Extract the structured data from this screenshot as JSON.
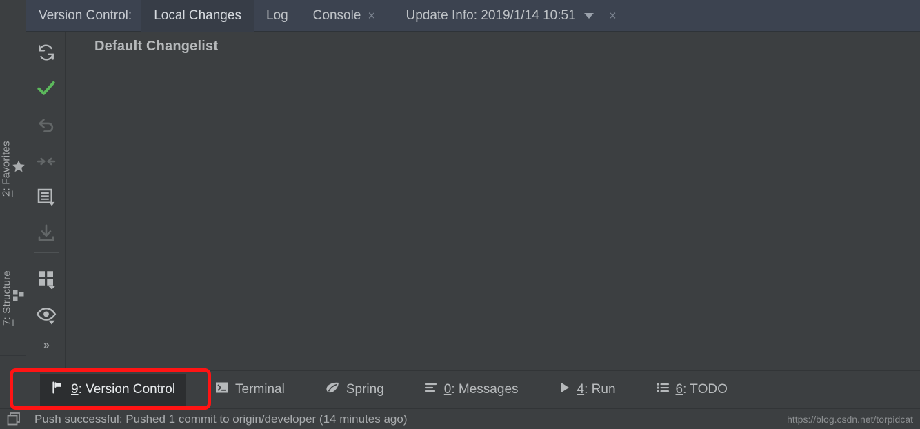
{
  "window": {
    "theme_bg": "#3C3F41",
    "tabbar_bg": "#3C4350",
    "accent_red": "#FF1414",
    "check_green": "#5CB85C"
  },
  "tabbar": {
    "label": "Version Control:",
    "tabs": [
      {
        "label": "Local Changes",
        "active": true,
        "closable": false
      },
      {
        "label": "Log",
        "active": false,
        "closable": false
      },
      {
        "label": "Console",
        "active": false,
        "closable": true,
        "close_glyph": "×"
      },
      {
        "label": "Update Info: 2019/1/14 10:51",
        "active": false,
        "closable": true,
        "has_caret": true,
        "close_glyph": "×"
      }
    ]
  },
  "left_rail": {
    "items": [
      {
        "label_prefix": "2",
        "label": ": Favorites",
        "icon": "star-icon"
      },
      {
        "label_prefix": "7",
        "label": ": Structure",
        "icon": "structure-icon"
      }
    ]
  },
  "vcs_toolbar": {
    "buttons": [
      {
        "name": "refresh-icon",
        "tooltip": "Refresh",
        "enabled": true
      },
      {
        "name": "commit-check-icon",
        "tooltip": "Commit",
        "enabled": true,
        "color": "#5CB85C"
      },
      {
        "name": "rollback-icon",
        "tooltip": "Rollback",
        "enabled": false
      },
      {
        "name": "shelve-icon",
        "tooltip": "Shelve Silently",
        "enabled": false
      },
      {
        "name": "changelist-icon",
        "tooltip": "Changelists",
        "enabled": true,
        "has_dropdown": true
      },
      {
        "name": "download-icon",
        "tooltip": "Get from Shelf",
        "enabled": false
      },
      {
        "name": "group-by-icon",
        "tooltip": "Group By",
        "enabled": true,
        "has_dropdown": true
      },
      {
        "name": "preview-eye-icon",
        "tooltip": "Preview Diff",
        "enabled": true,
        "has_dropdown": true
      }
    ],
    "more_label": "»"
  },
  "content": {
    "changelist_title": "Default Changelist"
  },
  "toolwindow_bar": {
    "buttons": [
      {
        "label_prefix": "9",
        "label": ": Version Control",
        "icon": "branch-icon",
        "selected": true
      },
      {
        "label_prefix": "",
        "label": "Terminal",
        "icon": "terminal-icon",
        "selected": false
      },
      {
        "label_prefix": "",
        "label": "Spring",
        "icon": "spring-leaf-icon",
        "selected": false
      },
      {
        "label_prefix": "0",
        "label": ": Messages",
        "icon": "messages-icon",
        "selected": false
      },
      {
        "label_prefix": "4",
        "label": ": Run",
        "icon": "run-play-icon",
        "selected": false
      },
      {
        "label_prefix": "6",
        "label": ": TODO",
        "icon": "todo-list-icon",
        "selected": false
      }
    ]
  },
  "statusbar": {
    "icon": "copy-windows-icon",
    "message": "Push successful: Pushed 1 commit to origin/developer (14 minutes ago)",
    "watermark": "https://blog.csdn.net/torpidcat"
  }
}
